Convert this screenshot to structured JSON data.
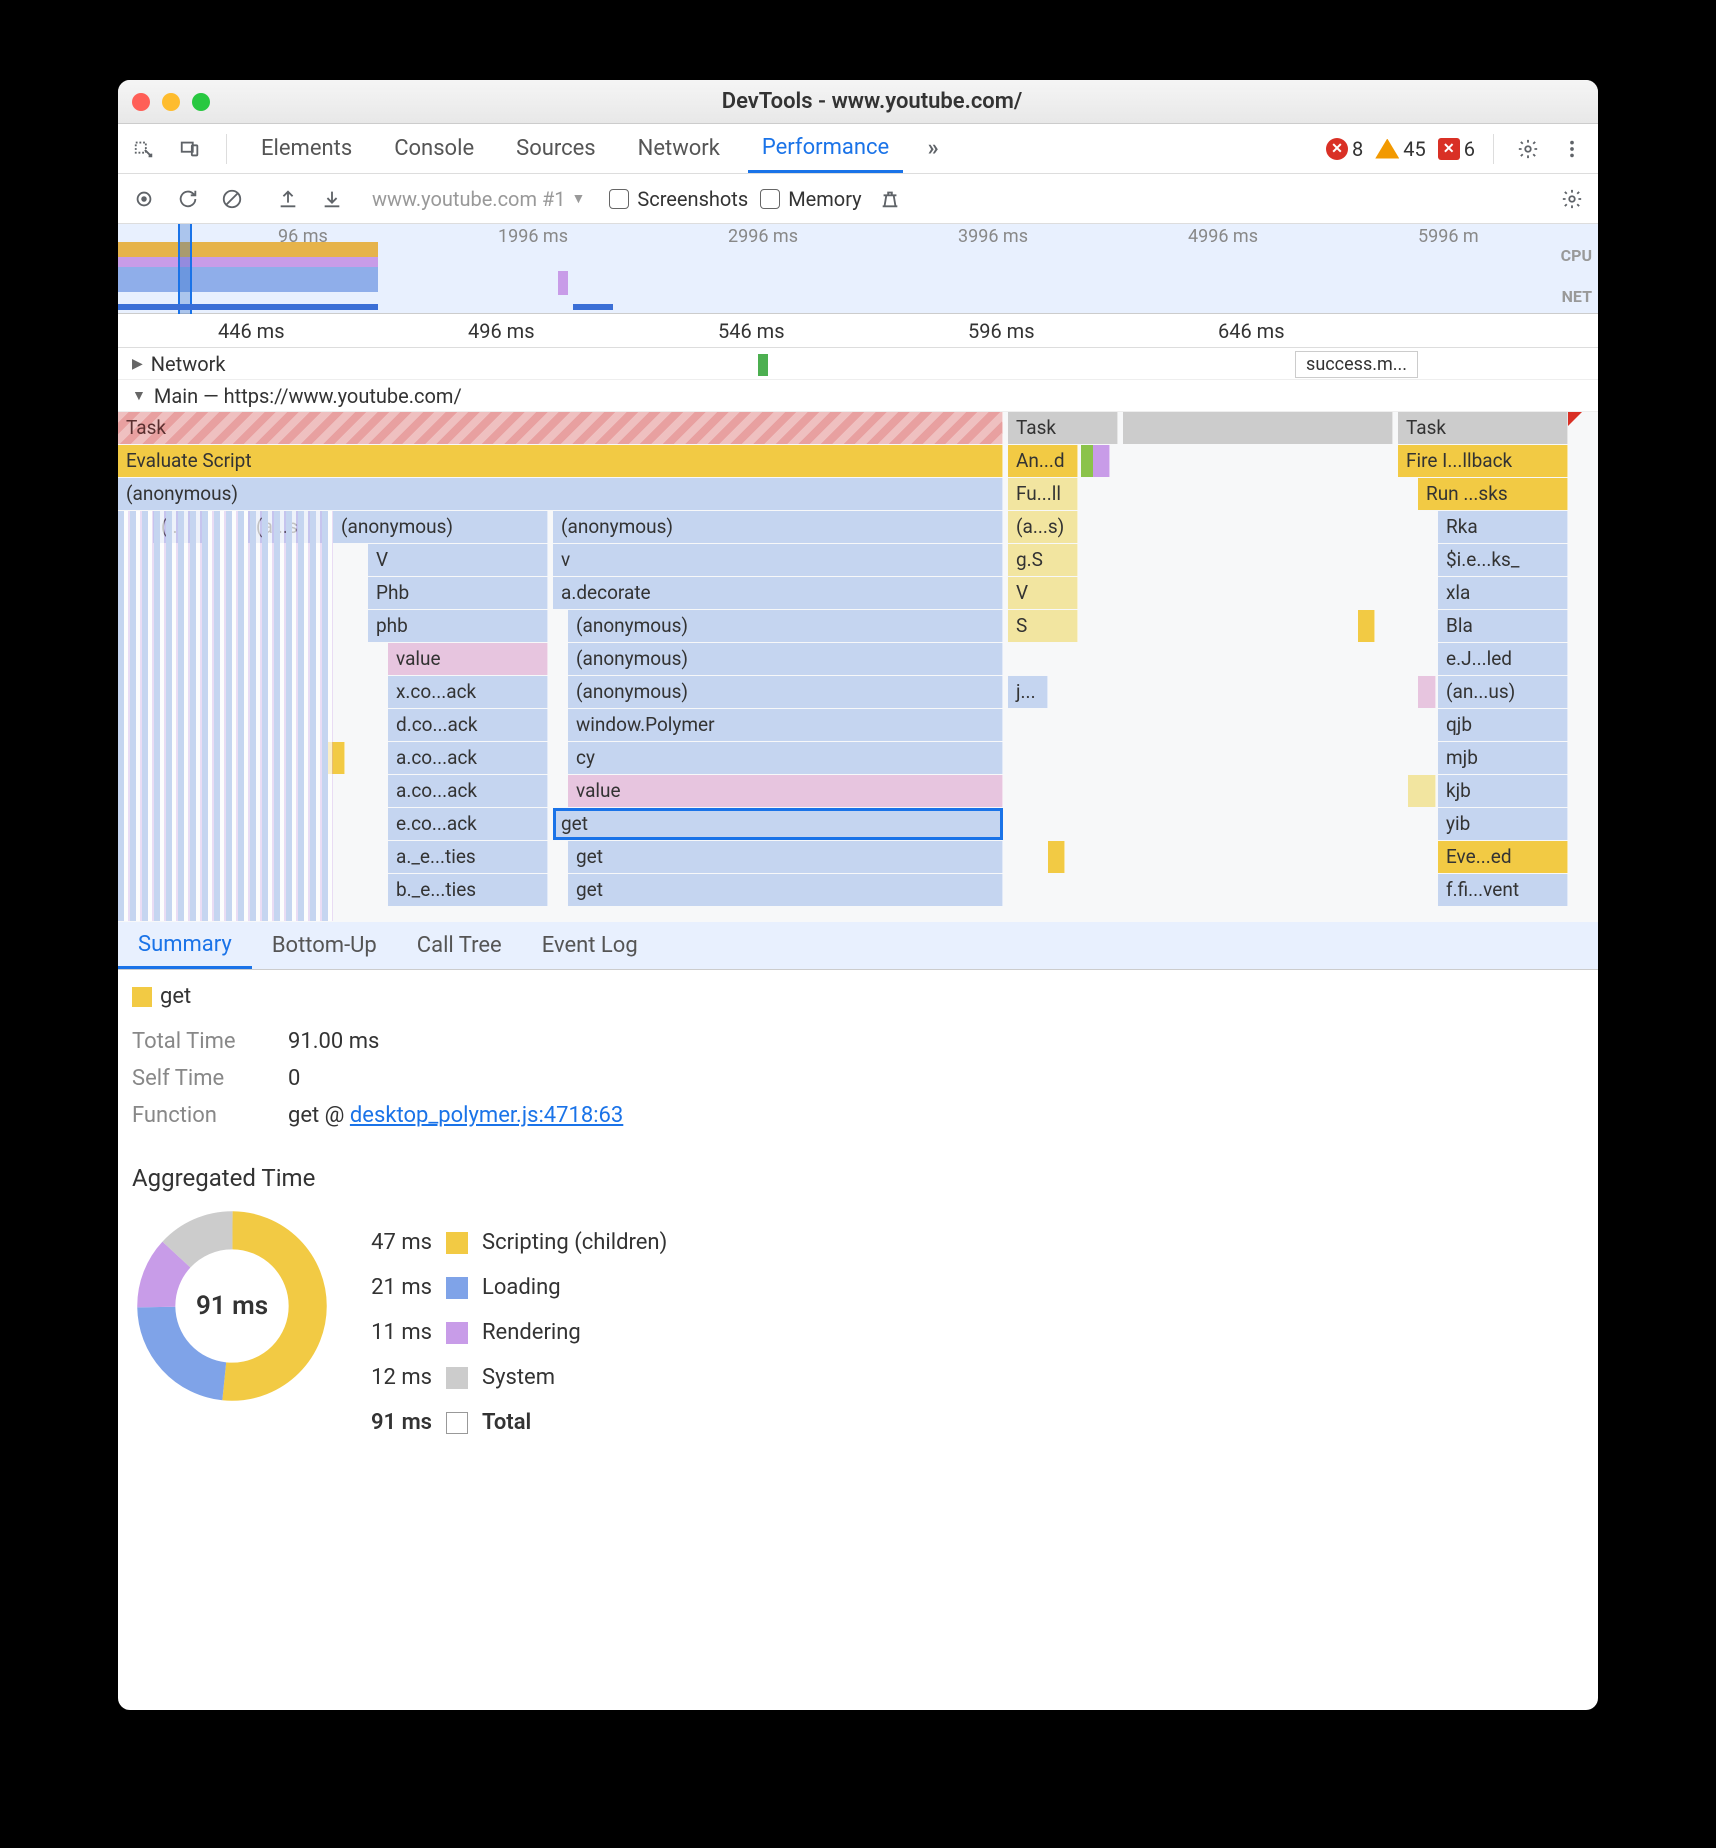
{
  "window": {
    "title": "DevTools - www.youtube.com/"
  },
  "main_tabs": {
    "elements": "Elements",
    "console": "Console",
    "sources": "Sources",
    "network": "Network",
    "performance": "Performance"
  },
  "warnings": {
    "errors": "8",
    "warnings": "45",
    "stop": "6"
  },
  "toolbar": {
    "trace_name": "www.youtube.com #1",
    "screenshots": "Screenshots",
    "memory": "Memory"
  },
  "overview": {
    "ticks": [
      "96 ms",
      "1996 ms",
      "2996 ms",
      "3996 ms",
      "4996 ms",
      "5996 m"
    ],
    "cpu": "CPU",
    "net": "NET"
  },
  "ruler": {
    "t0": "446 ms",
    "t1": "496 ms",
    "t2": "546 ms",
    "t3": "596 ms",
    "t4": "646 ms"
  },
  "tracks": {
    "network_label": "Network",
    "network_marker": "success.m...",
    "main_label": "Main — https://www.youtube.com/"
  },
  "flame": {
    "c1": {
      "task": "Task",
      "evaluate": "Evaluate Script",
      "anon": "(anonymous)",
      "s1a": "(...",
      "s1b": "(a...s)",
      "s2": "(anonymous)",
      "s3": "(anonymous)",
      "V": "V",
      "v": "v",
      "Phb": "Phb",
      "adec": "a.decorate",
      "phb": "phb",
      "anon2": "(anonymous)",
      "value": "value",
      "anon3": "(anonymous)",
      "xco": "x.co...ack",
      "anon4": "(anonymous)",
      "dco": "d.co...ack",
      "wp": "window.Polymer",
      "aco": "a.co...ack",
      "cy": "cy",
      "aco2": "a.co...ack",
      "value2": "value",
      "eco": "e.co...ack",
      "get": "get",
      "ae": "a._e...ties",
      "get2": "get",
      "be": "b._e...ties",
      "get3": "get"
    },
    "c2": {
      "task": "Task",
      "and": "An...d",
      "full": "Fu...ll",
      "as": "(a...s)",
      "gS": "g.S",
      "V": "V",
      "S": "S",
      "j": "j..."
    },
    "c3": {
      "task": "Task",
      "fire": "Fire I...llback",
      "run": "Run ...sks",
      "Rka": "Rka",
      "sie": "$i.e...ks_",
      "xla": "xla",
      "Bla": "Bla",
      "eJ": "e.J...led",
      "anus": "(an...us)",
      "qjb": "qjb",
      "mjb": "mjb",
      "kjb": "kjb",
      "yib": "yib",
      "eve": "Eve...ed",
      "ffi": "f.fi...vent"
    }
  },
  "detail_tabs": {
    "summary": "Summary",
    "bottomup": "Bottom-Up",
    "calltree": "Call Tree",
    "eventlog": "Event Log"
  },
  "summary": {
    "name": "get",
    "tt_label": "Total Time",
    "tt_val": "91.00 ms",
    "st_label": "Self Time",
    "st_val": "0",
    "fn_label": "Function",
    "fn_prefix": "get @ ",
    "fn_link": "desktop_polymer.js:4718:63",
    "agg_title": "Aggregated Time",
    "center": "91 ms",
    "legend": {
      "scripting": {
        "t": "47 ms",
        "l": "Scripting (children)",
        "c": "#f2ca44"
      },
      "loading": {
        "t": "21 ms",
        "l": "Loading",
        "c": "#7fa3e8"
      },
      "rendering": {
        "t": "11 ms",
        "l": "Rendering",
        "c": "#c89ce8"
      },
      "system": {
        "t": "12 ms",
        "l": "System",
        "c": "#ccc"
      },
      "total": {
        "t": "91 ms",
        "l": "Total",
        "c": "#fff"
      }
    }
  },
  "chart_data": {
    "type": "pie",
    "title": "Aggregated Time",
    "categories": [
      "Scripting (children)",
      "Loading",
      "Rendering",
      "System"
    ],
    "values": [
      47,
      21,
      11,
      12
    ],
    "total": 91,
    "unit": "ms",
    "colors": [
      "#f2ca44",
      "#7fa3e8",
      "#c89ce8",
      "#cccccc"
    ]
  }
}
